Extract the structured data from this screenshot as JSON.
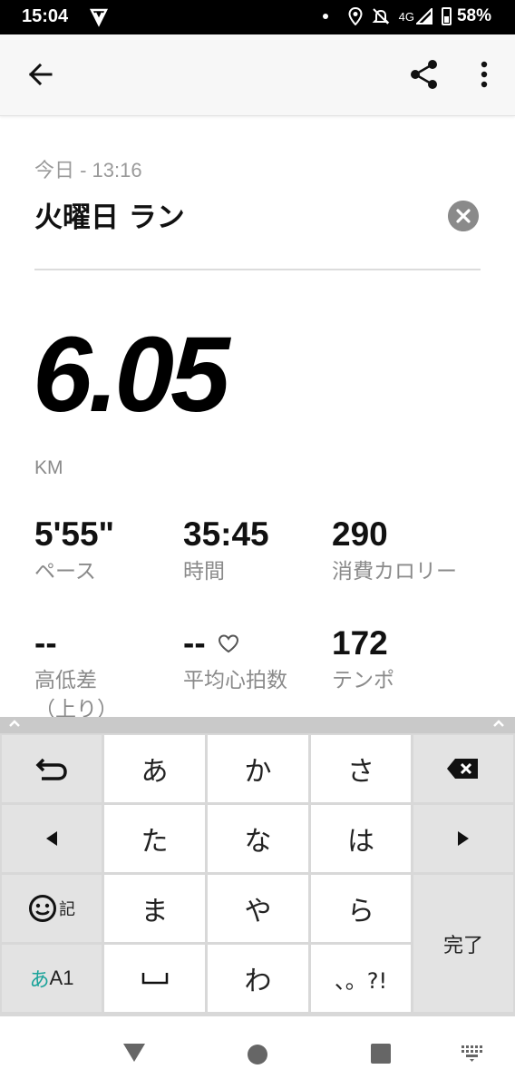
{
  "status_bar": {
    "time": "15:04",
    "network": "4G",
    "battery": "58%",
    "icons": [
      "app-notification-icon",
      "dot-icon",
      "location-icon",
      "silent-bell-icon",
      "signal-icon",
      "battery-icon"
    ]
  },
  "app_bar": {
    "back_icon": "arrow-left-icon",
    "share_icon": "share-icon",
    "more_icon": "more-vertical-icon"
  },
  "activity": {
    "date": "今日 - 13:16",
    "title": "火曜日 ラン",
    "distance": "6.05",
    "unit": "KM"
  },
  "stats": [
    {
      "value": "5'55\"",
      "label": "ペース"
    },
    {
      "value": "35:45",
      "label": "時間"
    },
    {
      "value": "290",
      "label": "消費カロリー"
    },
    {
      "value": "--",
      "label": "高低差\n（上り）"
    },
    {
      "value": "--",
      "label": "平均心拍数"
    },
    {
      "value": "172",
      "label": "テンポ"
    }
  ],
  "keyboard": {
    "keys": {
      "undo": "",
      "a": "あ",
      "ka": "か",
      "sa": "さ",
      "left": "",
      "ta": "た",
      "na": "な",
      "ha": "は",
      "right": "",
      "emoji_label": "記",
      "ma": "ま",
      "ya": "や",
      "ra": "ら",
      "done": "完了",
      "mode_a": "あ",
      "mode_rest": "A1",
      "space": "␣",
      "wa": "わ",
      "punct": "、。?!"
    }
  },
  "colors": {
    "accent_teal": "#1aa39a",
    "text_gray": "#8a8a8a"
  }
}
